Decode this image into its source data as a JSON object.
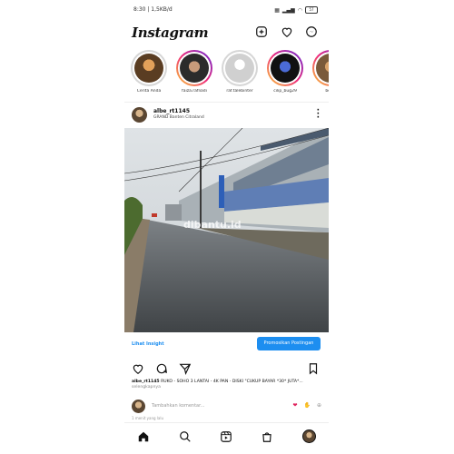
{
  "status_bar": {
    "time": "8:30 | 1,5KB/d",
    "battery": "57"
  },
  "app": {
    "logo": "Instagram"
  },
  "stories": [
    {
      "label": "Cerita Anda",
      "seen": false
    },
    {
      "label": "faiza.rafliadi",
      "seen": false
    },
    {
      "label": "raf.talebinter",
      "seen": true
    },
    {
      "label": "cilip_bug29",
      "seen": false
    },
    {
      "label": "bend",
      "seen": false
    }
  ],
  "post": {
    "username": "albe_rt1145",
    "location": "GRAND Banten Citraland",
    "watermark": "dibantu.id",
    "cta_link": "Lihat Insight",
    "cta_button": "Promosikan Postingan",
    "caption_user": "albe_rt1145",
    "caption_text": "RUKO - SOHO 3 LANTAI - 4K PAN - DISKI \"CUKUP BAYAR *30* JUTA*...",
    "caption_more": "selengkapnya",
    "comment_placeholder": "Tambahkan komentar...",
    "time_ago": "1 menit yang lalu"
  },
  "colors": {
    "accent": "#1d8ef0",
    "story_gradient": [
      "#f9ce34",
      "#ee2a7b",
      "#6228d7"
    ]
  }
}
